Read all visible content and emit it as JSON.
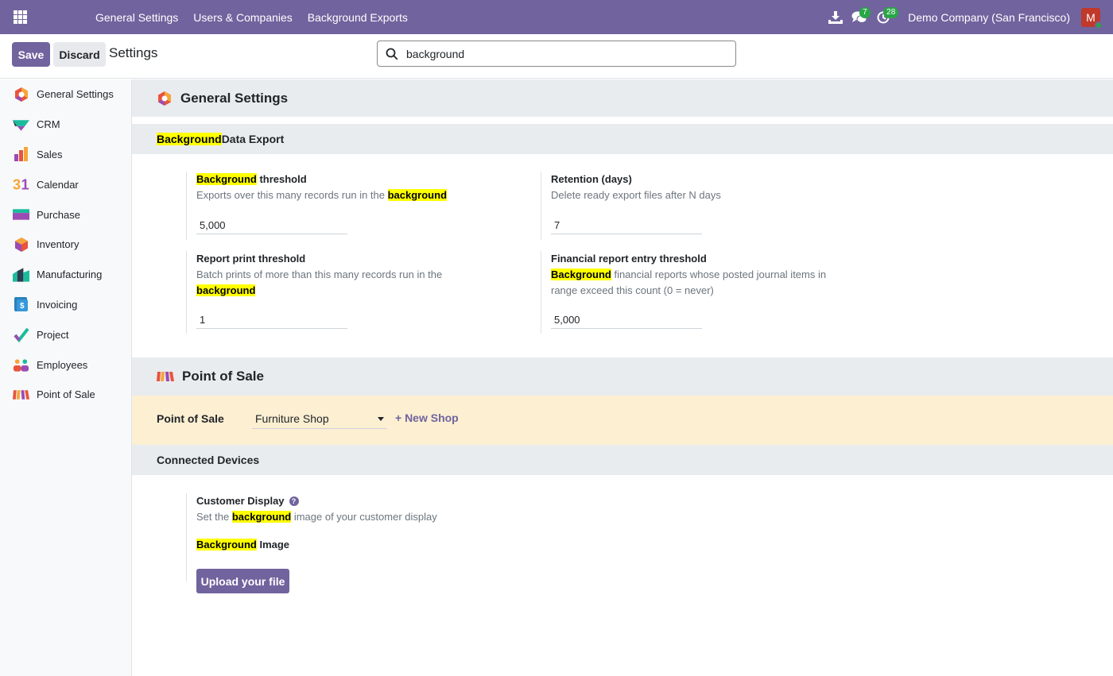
{
  "topbar": {
    "menu": [
      "General Settings",
      "Users & Companies",
      "Background Exports"
    ],
    "chat_count": "7",
    "activity_count": "28",
    "company": "Demo Company (San Francisco)",
    "avatar_letter": "M"
  },
  "control": {
    "save_label": "Save",
    "discard_label": "Discard",
    "breadcrumb": "Settings",
    "search_value": "background"
  },
  "sidebar": {
    "items": [
      {
        "label": "General Settings",
        "icon": "general-settings-icon"
      },
      {
        "label": "CRM",
        "icon": "crm-icon"
      },
      {
        "label": "Sales",
        "icon": "sales-icon"
      },
      {
        "label": "Calendar",
        "icon": "calendar-icon"
      },
      {
        "label": "Purchase",
        "icon": "purchase-icon"
      },
      {
        "label": "Inventory",
        "icon": "inventory-icon"
      },
      {
        "label": "Manufacturing",
        "icon": "manufacturing-icon"
      },
      {
        "label": "Invoicing",
        "icon": "invoicing-icon"
      },
      {
        "label": "Project",
        "icon": "project-icon"
      },
      {
        "label": "Employees",
        "icon": "employees-icon"
      },
      {
        "label": "Point of Sale",
        "icon": "point-of-sale-icon"
      }
    ]
  },
  "general": {
    "title": "General Settings",
    "section_hl": "Background",
    "section_rest": " Data Export",
    "bg_threshold": {
      "title_hl": "Background",
      "title_rest": " threshold",
      "desc_pre": "Exports over this many records run in the ",
      "desc_hl": "background",
      "value": "5,000"
    },
    "retention": {
      "title": "Retention (days)",
      "desc": "Delete ready export files after N days",
      "value": "7"
    },
    "report_print": {
      "title": "Report print threshold",
      "desc_pre": "Batch prints of more than this many records run in the ",
      "desc_hl": "background",
      "value": "1"
    },
    "financial": {
      "title": "Financial report entry threshold",
      "desc_hl": "Background",
      "desc_rest": " financial reports whose posted journal items in range exceed this count (0 = never)",
      "value": "5,000"
    }
  },
  "pos": {
    "title": "Point of Sale",
    "row_label": "Point of Sale",
    "selected_shop": "Furniture Shop",
    "new_shop": "+ New Shop",
    "connected_devices": "Connected Devices",
    "customer_display": {
      "title": "Customer Display",
      "help": "?",
      "desc_pre": "Set the ",
      "desc_hl": "background",
      "desc_rest": " image of your customer display",
      "image_hl": "Background",
      "image_rest": " Image",
      "upload_label": "Upload your file"
    }
  }
}
